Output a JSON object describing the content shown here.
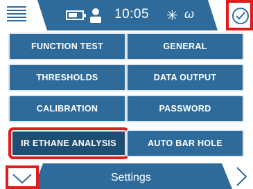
{
  "status_bar": {
    "time": "10:05",
    "bluetooth_symbol": "✳",
    "signal_symbol": "ω",
    "icons": [
      "menu-icon",
      "battery-icon",
      "user-icon",
      "bluetooth-icon",
      "signal-icon",
      "check-icon"
    ]
  },
  "menu": {
    "items": [
      {
        "label": "FUNCTION TEST"
      },
      {
        "label": "GENERAL"
      },
      {
        "label": "THRESHOLDS"
      },
      {
        "label": "DATA OUTPUT"
      },
      {
        "label": "CALIBRATION"
      },
      {
        "label": "PASSWORD"
      },
      {
        "label": "IR ETHANE ANALYSIS",
        "selected": true
      },
      {
        "label": "AUTO BAR HOLE"
      }
    ]
  },
  "bottom_bar": {
    "title": "Settings",
    "icons": [
      "chevron-down-icon",
      "chevron-right-icon"
    ]
  },
  "colors": {
    "primary": "#2f6b9a",
    "selected": "#1f4e74",
    "highlight": "#e21b1b"
  }
}
